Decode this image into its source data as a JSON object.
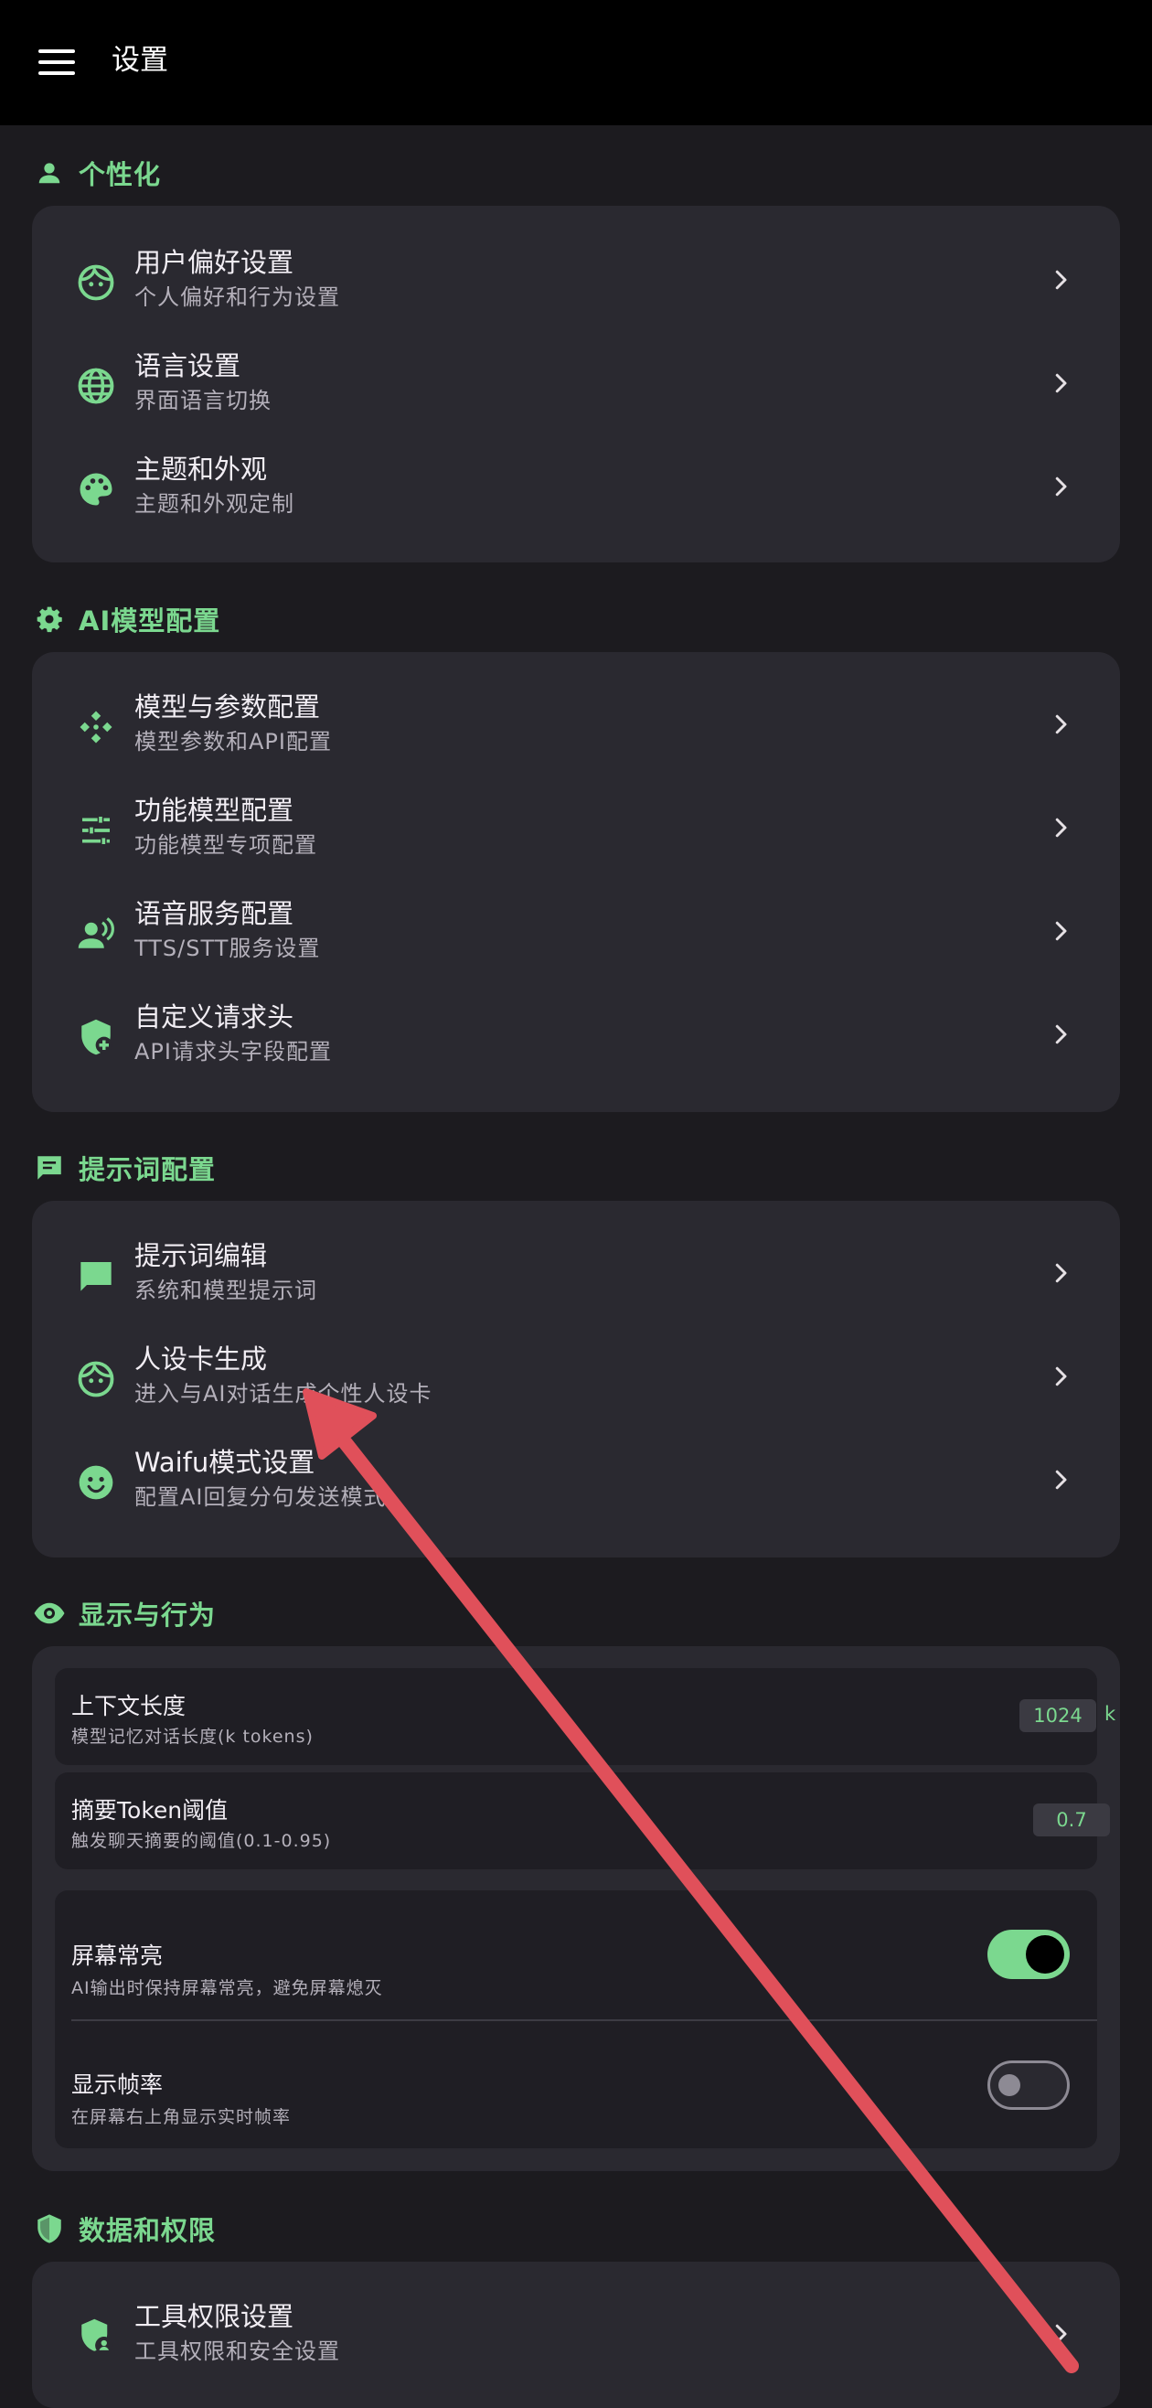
{
  "app": {
    "title": "设置"
  },
  "colors": {
    "accent": "#7bd88f",
    "background": "#1c1b1f",
    "card": "#2a2930",
    "annotation_arrow": "#e0505a"
  },
  "sections": {
    "personalization": {
      "header": "个性化",
      "icon": "person-icon",
      "items": [
        {
          "title": "用户偏好设置",
          "subtitle": "个人偏好和行为设置",
          "icon": "face-icon"
        },
        {
          "title": "语言设置",
          "subtitle": "界面语言切换",
          "icon": "globe-icon"
        },
        {
          "title": "主题和外观",
          "subtitle": "主题和外观定制",
          "icon": "palette-icon"
        }
      ]
    },
    "ai_model": {
      "header": "AI模型配置",
      "icon": "gear-icon",
      "items": [
        {
          "title": "模型与参数配置",
          "subtitle": "模型参数和API配置",
          "icon": "hub-icon"
        },
        {
          "title": "功能模型配置",
          "subtitle": "功能模型专项配置",
          "icon": "tune-icon"
        },
        {
          "title": "语音服务配置",
          "subtitle": "TTS/STT服务设置",
          "icon": "voice-person-icon"
        },
        {
          "title": "自定义请求头",
          "subtitle": "API请求头字段配置",
          "icon": "shield-plus-icon"
        }
      ]
    },
    "prompt": {
      "header": "提示词配置",
      "icon": "chat-icon",
      "items": [
        {
          "title": "提示词编辑",
          "subtitle": "系统和模型提示词",
          "icon": "chat-bubble-icon"
        },
        {
          "title": "人设卡生成",
          "subtitle": "进入与AI对话生成个性人设卡",
          "icon": "face-icon"
        },
        {
          "title": "Waifu模式设置",
          "subtitle": "配置AI回复分句发送模式",
          "icon": "smiley-icon"
        }
      ]
    },
    "display": {
      "header": "显示与行为",
      "icon": "eye-icon",
      "context_length": {
        "title": "上下文长度",
        "subtitle": "模型记忆对话长度(k tokens)",
        "value": "1024",
        "unit": "k"
      },
      "summary_threshold": {
        "title": "摘要Token阈值",
        "subtitle": "触发聊天摘要的阈值(0.1-0.95)",
        "value": "0.7"
      },
      "screen_on": {
        "title": "屏幕常亮",
        "subtitle": "AI输出时保持屏幕常亮，避免屏幕熄灭",
        "enabled": true
      },
      "show_fps": {
        "title": "显示帧率",
        "subtitle": "在屏幕右上角显示实时帧率",
        "enabled": false
      }
    },
    "data_permissions": {
      "header": "数据和权限",
      "icon": "shield-icon",
      "items": [
        {
          "title": "工具权限设置",
          "subtitle": "工具权限和安全设置",
          "icon": "shield-person-icon"
        }
      ]
    }
  }
}
